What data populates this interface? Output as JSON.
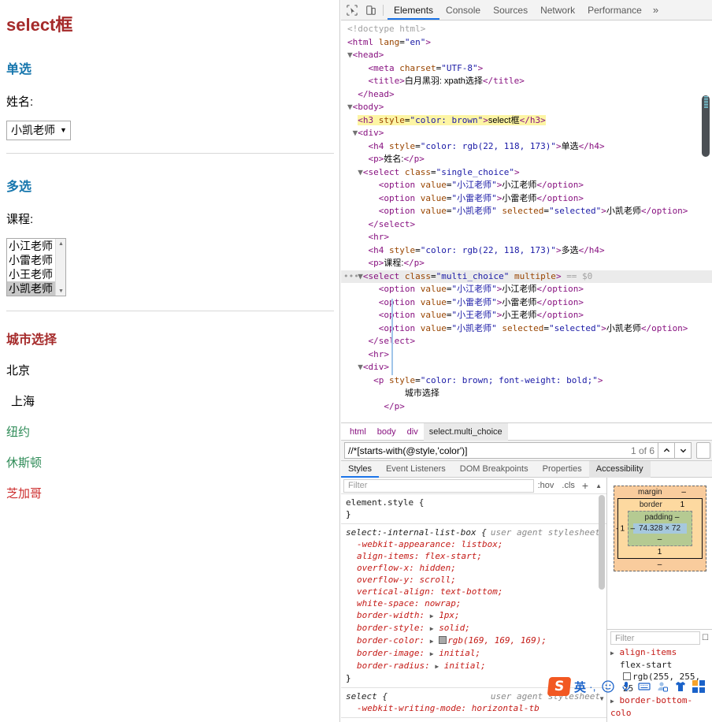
{
  "page": {
    "h3_title": "select框",
    "h3_color": "brown",
    "single": {
      "heading": "单选",
      "heading_color": "rgb(22, 118, 173)",
      "label": "姓名:",
      "selected_value": "小凯老师",
      "arrow": "▼",
      "options": [
        "小江老师",
        "小雷老师",
        "小凯老师"
      ]
    },
    "multi": {
      "heading": "多选",
      "heading_color": "rgb(22, 118, 173)",
      "label": "课程:",
      "options": [
        {
          "label": "小江老师",
          "selected": false
        },
        {
          "label": "小雷老师",
          "selected": false
        },
        {
          "label": "小王老师",
          "selected": false
        },
        {
          "label": "小凯老师",
          "selected": true
        }
      ],
      "scroll_up": "▲",
      "scroll_down": "▼"
    },
    "city": {
      "title": "城市选择",
      "title_color": "brown",
      "items": [
        {
          "name": "北京",
          "color": "#000000"
        },
        {
          "name": "上海",
          "color": "#000000"
        },
        {
          "name": "纽约",
          "color": "#2e8b57"
        },
        {
          "name": "休斯顿",
          "color": "#2e8b57"
        },
        {
          "name": "芝加哥",
          "color": "#cc2b2b"
        }
      ]
    }
  },
  "devtools": {
    "toolbar": {
      "inspect_icon": "inspect-cursor-icon",
      "device_icon": "device-toolbar-icon",
      "more_tabs": "»",
      "tabs": [
        {
          "label": "Elements",
          "active": true
        },
        {
          "label": "Console",
          "active": false
        },
        {
          "label": "Sources",
          "active": false
        },
        {
          "label": "Network",
          "active": false
        },
        {
          "label": "Performance",
          "active": false
        }
      ]
    },
    "dom_lines": [
      "<!doctype html>",
      "<html lang=\"en\">",
      "<head>",
      "<meta charset=\"UTF-8\">",
      "<title>白月黑羽: xpath选择</title>",
      "</head>",
      "<body>",
      "<h3 style=\"color: brown\">select框</h3>",
      "<div>",
      "<h4 style=\"color: rgb(22, 118, 173)\">单选</h4>",
      "<p>姓名:</p>",
      "<select class=\"single_choice\">",
      "<option value=\"小江老师\">小江老师</option>",
      "<option value=\"小雷老师\">小雷老师</option>",
      "<option value=\"小凯老师\" selected=\"selected\">小凯老师</option>",
      "</select>",
      "<hr>",
      "<h4 style=\"color: rgb(22, 118, 173)\">多选</h4>",
      "<p>课程:</p>",
      "<select class=\"multi_choice\" multiple> == $0",
      "<option value=\"小江老师\">小江老师</option>",
      "<option value=\"小雷老师\">小雷老师</option>",
      "<option value=\"小王老师\">小王老师</option>",
      "<option value=\"小凯老师\" selected=\"selected\">小凯老师</option>",
      "</select>",
      "<hr>",
      "<div>",
      "<p style=\"color: brown; font-weight: bold;\">",
      "城市选择",
      "</p>"
    ],
    "breadcrumb": [
      "html",
      "body",
      "div",
      "select.multi_choice"
    ],
    "search": {
      "value": "//*[starts-with(@style,'color')]",
      "matches": "1 of 6",
      "prev_icon": "^",
      "next_icon": "v"
    },
    "subtabs": [
      {
        "label": "Styles",
        "active": true
      },
      {
        "label": "Event Listeners",
        "active": false
      },
      {
        "label": "DOM Breakpoints",
        "active": false
      },
      {
        "label": "Properties",
        "active": false
      },
      {
        "label": "Accessibility",
        "active": false,
        "hover": true
      }
    ],
    "styles": {
      "filter_placeholder": "Filter",
      "hov_label": ":hov",
      "cls_label": ".cls",
      "plus_label": "+",
      "element_style": "element.style {",
      "element_style_close": "}",
      "rule1_selector": "select:-internal-list-box {",
      "rule1_origin": "user agent stylesheet",
      "rule1_props": [
        {
          "name": "-webkit-appearance",
          "value": "listbox;",
          "expand": false
        },
        {
          "name": "align-items",
          "value": "flex-start;",
          "expand": false
        },
        {
          "name": "overflow-x",
          "value": "hidden;",
          "expand": false
        },
        {
          "name": "overflow-y",
          "value": "scroll;",
          "expand": false
        },
        {
          "name": "vertical-align",
          "value": "text-bottom;",
          "expand": false
        },
        {
          "name": "white-space",
          "value": "nowrap;",
          "expand": false
        },
        {
          "name": "border-width",
          "value": "1px;",
          "expand": true
        },
        {
          "name": "border-style",
          "value": "solid;",
          "expand": true
        },
        {
          "name": "border-color",
          "value": "rgb(169, 169, 169);",
          "expand": true,
          "swatch": "#a9a9a9"
        },
        {
          "name": "border-image",
          "value": "initial;",
          "expand": true
        },
        {
          "name": "border-radius",
          "value": "initial;",
          "expand": true
        }
      ],
      "rule1_close": "}",
      "rule2_selector": "select {",
      "rule2_origin": "user agent stylesheet",
      "rule2_prop": "-webkit-writing-mode: horizontal-tb"
    },
    "boxmodel": {
      "margin_label": "margin",
      "border_label": "border",
      "padding_label": "padding",
      "content_size": "74.328 × 72",
      "margin_top": "–",
      "margin_bottom": "–",
      "margin_left": "–",
      "border_top": "1",
      "border_bottom": "1",
      "border_left": "1",
      "padding_top": "–",
      "padding_bottom": "–",
      "padding_left": "–"
    },
    "computed": {
      "filter_placeholder": "Filter",
      "rows": [
        {
          "prop": "align-items",
          "value": "flex-start"
        },
        {
          "prop": "",
          "value": "rgb(255, 255, 25",
          "swatch": "#ffffff"
        },
        {
          "prop": "border-bottom-colo",
          "value": ""
        }
      ]
    }
  },
  "ime": {
    "logo": "S",
    "lang": "英",
    "punct": "·,",
    "icons": [
      "emoji-icon",
      "microphone-icon",
      "keyboard-icon",
      "user-icon",
      "skin-icon",
      "apps-grid-icon"
    ]
  }
}
